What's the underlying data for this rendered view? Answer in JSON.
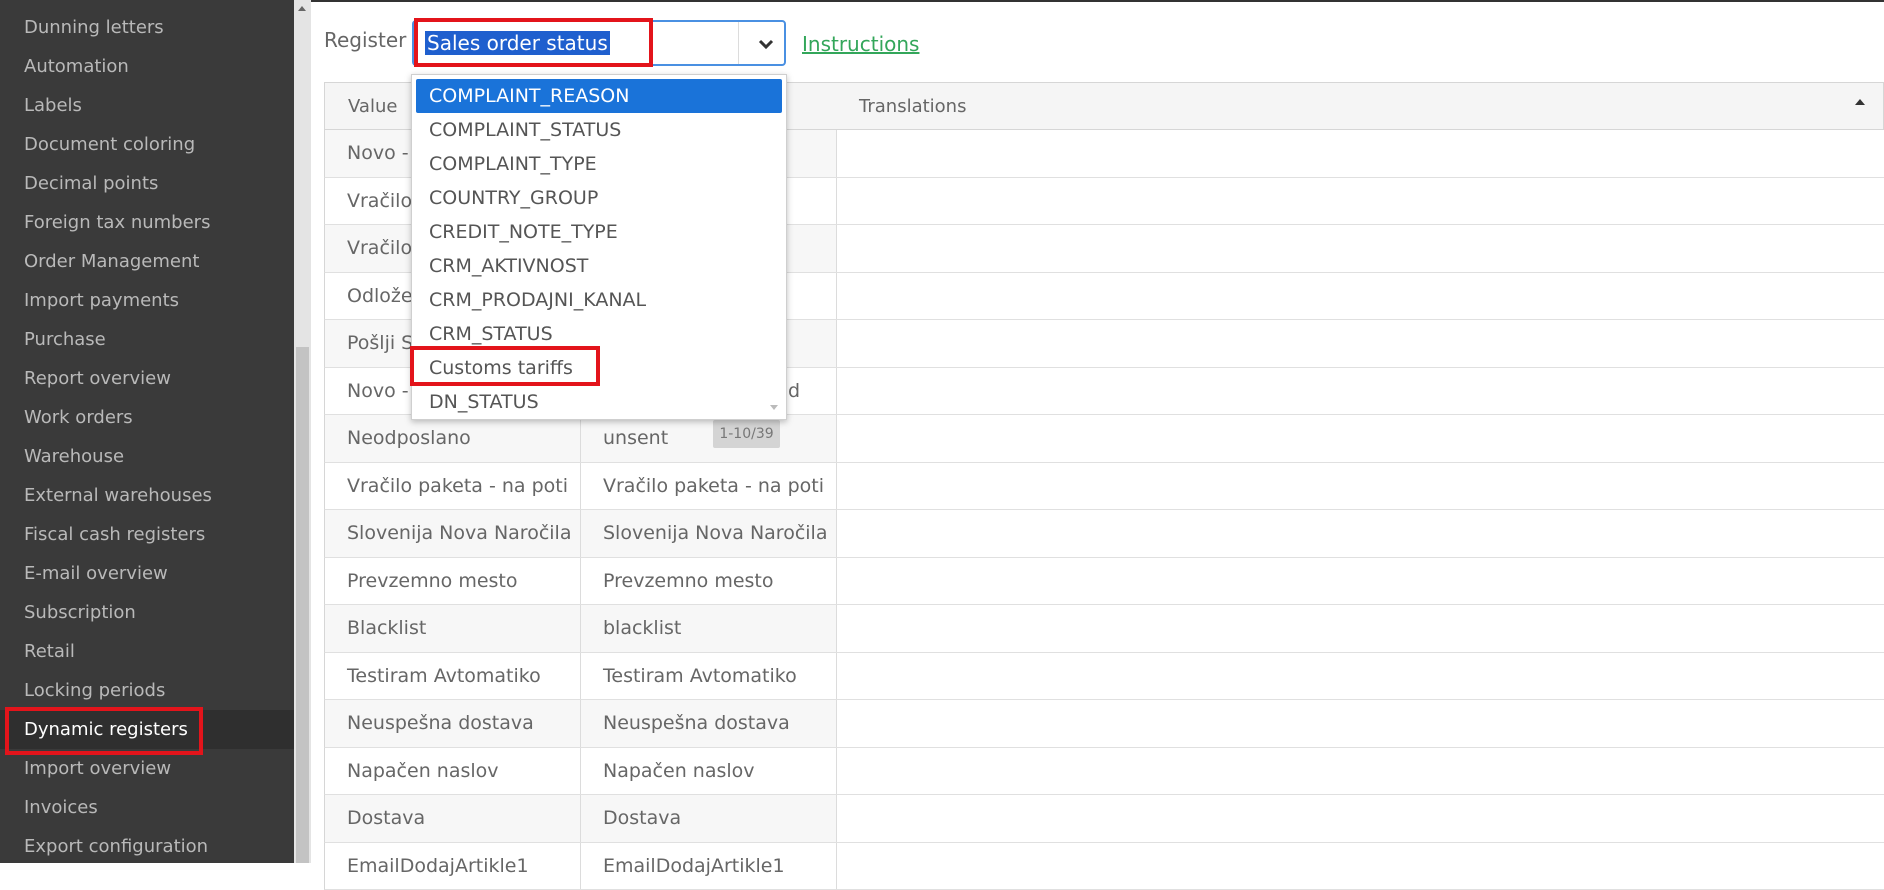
{
  "sidebar": {
    "items": [
      {
        "label": "Dunning letters"
      },
      {
        "label": "Automation"
      },
      {
        "label": "Labels"
      },
      {
        "label": "Document coloring"
      },
      {
        "label": "Decimal points"
      },
      {
        "label": "Foreign tax numbers"
      },
      {
        "label": "Order Management"
      },
      {
        "label": "Import payments"
      },
      {
        "label": "Purchase"
      },
      {
        "label": "Report overview"
      },
      {
        "label": "Work orders"
      },
      {
        "label": "Warehouse"
      },
      {
        "label": "External warehouses"
      },
      {
        "label": "Fiscal cash registers"
      },
      {
        "label": "E-mail overview"
      },
      {
        "label": "Subscription"
      },
      {
        "label": "Retail"
      },
      {
        "label": "Locking periods"
      },
      {
        "label": "Dynamic registers",
        "active": true
      },
      {
        "label": "Import overview"
      },
      {
        "label": "Invoices"
      },
      {
        "label": "Export configuration"
      }
    ]
  },
  "register": {
    "label": "Register",
    "selected_value": "Sales order status",
    "instructions_label": "Instructions",
    "options": [
      "COMPLAINT_REASON",
      "COMPLAINT_STATUS",
      "COMPLAINT_TYPE",
      "COUNTRY_GROUP",
      "CREDIT_NOTE_TYPE",
      "CRM_AKTIVNOST",
      "CRM_PRODAJNI_KANAL",
      "CRM_STATUS",
      "Customs tariffs",
      "DN_STATUS"
    ],
    "highlighted_option": "COMPLAINT_REASON"
  },
  "table": {
    "headers": {
      "value": "Value",
      "translations": "Translations"
    },
    "rows": [
      {
        "value": "Novo -",
        "code": ""
      },
      {
        "value": "Vračilo",
        "code": ""
      },
      {
        "value": "Vračilo",
        "code": ""
      },
      {
        "value": "Odlože",
        "code": ""
      },
      {
        "value": "Pošlji S",
        "code": ""
      },
      {
        "value": "Novo -",
        "code": "d"
      },
      {
        "value": "Neodposlano",
        "code": "unsent"
      },
      {
        "value": "Vračilo paketa - na poti",
        "code": "Vračilo paketa - na poti"
      },
      {
        "value": "Slovenija Nova Naročila",
        "code": "Slovenija Nova Naročila"
      },
      {
        "value": "Prevzemno mesto",
        "code": "Prevzemno mesto"
      },
      {
        "value": "Blacklist",
        "code": "blacklist"
      },
      {
        "value": "Testiram Avtomatiko",
        "code": "Testiram Avtomatiko"
      },
      {
        "value": "Neuspešna dostava",
        "code": "Neuspešna dostava"
      },
      {
        "value": "Napačen naslov",
        "code": "Napačen naslov"
      },
      {
        "value": "Dostava",
        "code": "Dostava"
      },
      {
        "value": "EmailDodajArtikle1",
        "code": "EmailDodajArtikle1"
      }
    ],
    "pager": "1-10/39"
  },
  "colors": {
    "sidebar_bg": "#3a3a3a",
    "highlight": "#e3141b",
    "link": "#33a65a",
    "selection": "#1a73d9"
  }
}
